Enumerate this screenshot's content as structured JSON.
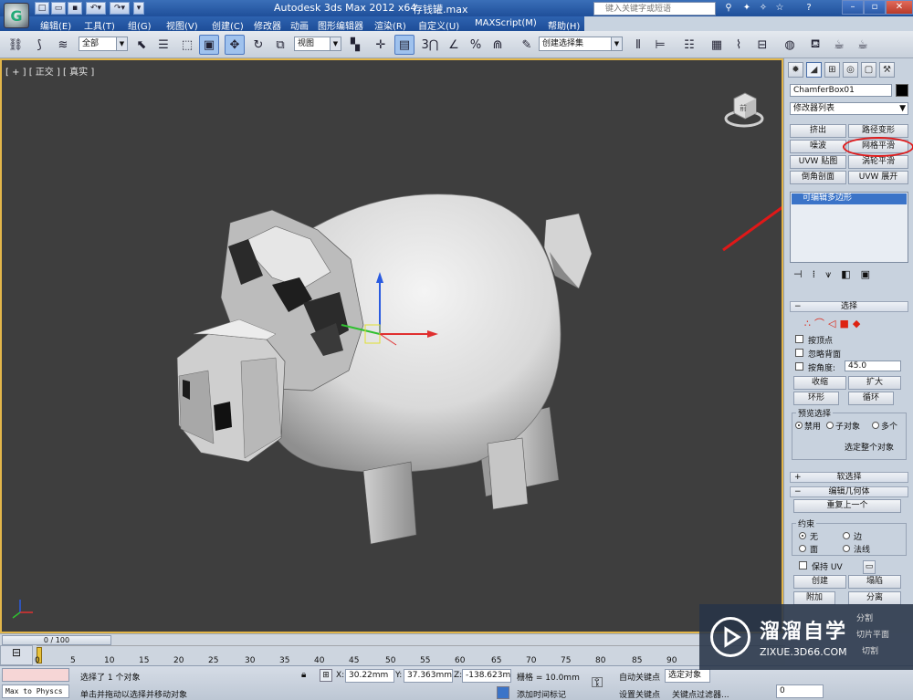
{
  "app": {
    "title": "Autodesk 3ds Max  2012 x64",
    "file": "存钱罐.max",
    "search_placeholder": "键入关键字或短语"
  },
  "menu": [
    "编辑(E)",
    "工具(T)",
    "组(G)",
    "视图(V)",
    "创建(C)",
    "修改器",
    "动画",
    "图形编辑器",
    "渲染(R)",
    "自定义(U)",
    "MAXScript(M)",
    "帮助(H)"
  ],
  "toolbar": {
    "selection_filter": "全部",
    "ref_coord": "视图",
    "named_selection": "创建选择集",
    "snap_3": "3",
    "angle_snap": "%",
    "percent_snap": "n"
  },
  "viewport": {
    "label": "[ + ] [ 正交 ] [ 真实 ]",
    "viewcube_text": "前"
  },
  "panel": {
    "object_name": "ChamferBox01",
    "modifier_list": "修改器列表",
    "modifier_buttons": [
      "挤出",
      "路径变形",
      "噪波",
      "网格平滑",
      "UVW 贴图",
      "涡轮平滑",
      "倒角剖面",
      "UVW 展开"
    ],
    "stack_item": "可编辑多边形",
    "rollout_selection": "选择",
    "by_vertex": "按顶点",
    "ignore_backfacing": "忽略背面",
    "by_angle": "按角度:",
    "angle_value": "45.0",
    "shrink": "收缩",
    "grow": "扩大",
    "ring": "环形",
    "loop": "循环",
    "preview_selection": "预览选择",
    "preview_options": [
      "禁用",
      "子对象",
      "多个"
    ],
    "whole_object": "选定整个对象",
    "soft_selection": "软选择",
    "edit_geometry": "编辑几何体",
    "repeat_last": "重复上一个",
    "constraints": "约束",
    "constraint_options": [
      "无",
      "边",
      "面",
      "法线"
    ],
    "preserve_uv": "保持 UV",
    "create": "创建",
    "collapse": "塌陷",
    "attach": "附加",
    "detach": "分离",
    "slice_plane": "切片平面",
    "cut": "切割",
    "split": "分割"
  },
  "timeline": {
    "slider": "0 / 100",
    "ticks": [
      "0",
      "5",
      "10",
      "15",
      "20",
      "25",
      "30",
      "35",
      "40",
      "45",
      "50",
      "55",
      "60",
      "65",
      "70",
      "75",
      "80",
      "85",
      "90"
    ]
  },
  "status": {
    "script_box": "Max to Physcs (",
    "selected": "选择了 1 个对象",
    "prompt": "单击并拖动以选择并移动对象",
    "x_label": "X:",
    "x_value": "30.22mm",
    "y_label": "Y:",
    "y_value": "37.363mm",
    "z_label": "Z:",
    "z_value": "-138.623m",
    "grid": "栅格 = 10.0mm",
    "auto_key": "自动关键点",
    "set_key": "设置关键点",
    "selected_obj": "选定对象",
    "key_filters": "关键点过滤器...",
    "add_time_tag": "添加时间标记",
    "frame_value": "0"
  },
  "watermark": {
    "title": "溜溜自学",
    "url": "ZIXUE.3D66.COM"
  },
  "colors": {
    "title_bar": "#1f4f9a",
    "viewport_bg": "#3e3e3e",
    "viewport_border": "#e2b64a",
    "annotation": "#e01818",
    "stack_highlight": "#3b74c8"
  }
}
